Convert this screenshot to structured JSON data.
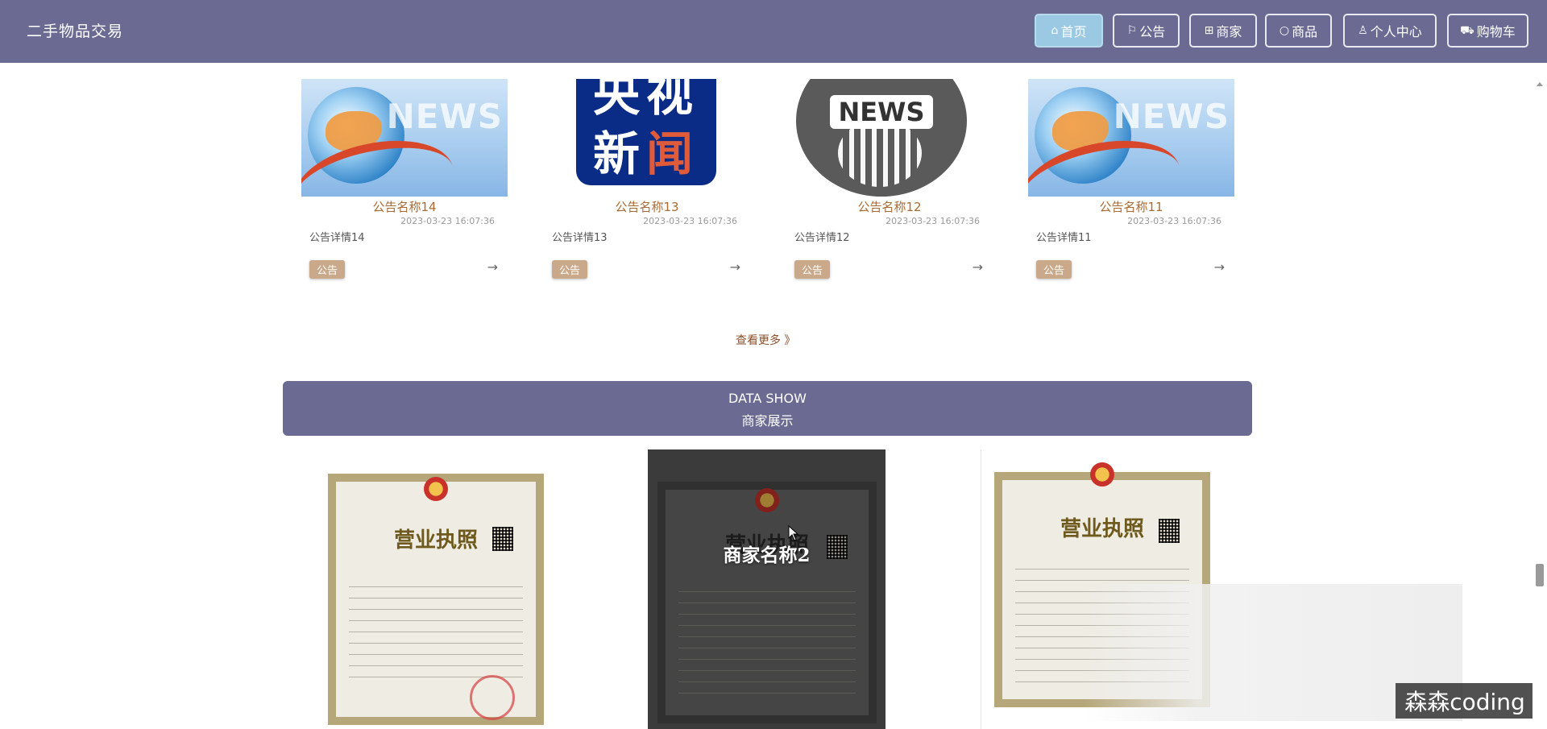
{
  "header": {
    "brand": "二手物品交易",
    "nav": [
      {
        "icon": "home-icon",
        "label": "首页",
        "active": true
      },
      {
        "icon": "flag-icon",
        "label": "公告",
        "active": false
      },
      {
        "icon": "shop-icon",
        "label": "商家",
        "active": false
      },
      {
        "icon": "circle-icon",
        "label": "商品",
        "active": false
      },
      {
        "icon": "user-icon",
        "label": "个人中心",
        "active": false
      },
      {
        "icon": "cart-icon",
        "label": "购物车",
        "active": false
      }
    ]
  },
  "notices": [
    {
      "title": "公告名称14",
      "date": "2023-03-23 16:07:36",
      "detail": "公告详情14",
      "tag": "公告",
      "arrow": "→",
      "image": "news-globe-image"
    },
    {
      "title": "公告名称13",
      "date": "2023-03-23 16:07:36",
      "detail": "公告详情13",
      "tag": "公告",
      "arrow": "→",
      "image": "cctv-news-image",
      "image_text": [
        "央视",
        "新闻"
      ]
    },
    {
      "title": "公告名称12",
      "date": "2023-03-23 16:07:36",
      "detail": "公告详情12",
      "tag": "公告",
      "arrow": "→",
      "image": "news-circle-image",
      "image_text": "NEWS"
    },
    {
      "title": "公告名称11",
      "date": "2023-03-23 16:07:36",
      "detail": "公告详情11",
      "tag": "公告",
      "arrow": "→",
      "image": "news-globe-image"
    }
  ],
  "news_banner_word": "NEWS",
  "more_link": "查看更多 》",
  "section": {
    "en": "DATA SHOW",
    "cn": "商家展示"
  },
  "merchants": [
    {
      "image": "business-license-image",
      "name": "",
      "license_heading": "营业执照"
    },
    {
      "image": "business-license-image",
      "name": "商家名称2",
      "hovered": true,
      "license_heading": "营业执照"
    },
    {
      "image": "business-license-image",
      "name": "",
      "license_heading": "营业执照"
    }
  ],
  "watermark": "森森coding",
  "colors": {
    "header_bg": "#6b6a93",
    "active_nav": "#9bc9e4",
    "title_brown": "#a86b33",
    "tag_bg": "#c9a98a"
  }
}
